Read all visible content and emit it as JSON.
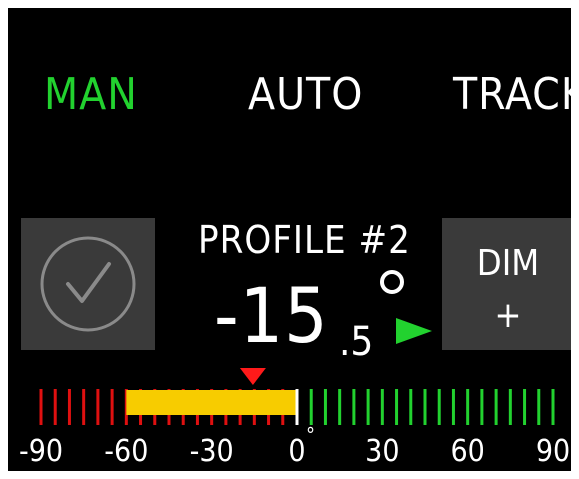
{
  "modes": {
    "man": "MAN",
    "auto": "AUTO",
    "track": "TRACK",
    "active": "MAN"
  },
  "profile": {
    "label": "PROFILE #2"
  },
  "angle": {
    "integer": "-15",
    "fraction": ".5",
    "degree_symbol": "°"
  },
  "dim_button": {
    "label": "DIM",
    "sub": "+"
  },
  "ok_button": {
    "icon": "checkmark-circle-icon"
  },
  "scale": {
    "min": -90,
    "max": 90,
    "tick_step": 5,
    "labels": [
      "-90",
      "-60",
      "-30",
      "0",
      "30",
      "60",
      "90"
    ],
    "zero_degree_mark": "°",
    "range_bar_from": -60,
    "range_bar_to": 0,
    "pointer_value": -15.5,
    "colors": {
      "negative_ticks": "#e01010",
      "positive_ticks": "#22d22f",
      "range_bar": "#f7cc00",
      "pointer": "#ff1a1a",
      "zero_tick": "#ffffff"
    }
  },
  "colors": {
    "active_mode": "#22d22f",
    "inactive_mode": "#ffffff",
    "button_bg": "#3a3a3a",
    "direction_arrow": "#22d22f"
  }
}
